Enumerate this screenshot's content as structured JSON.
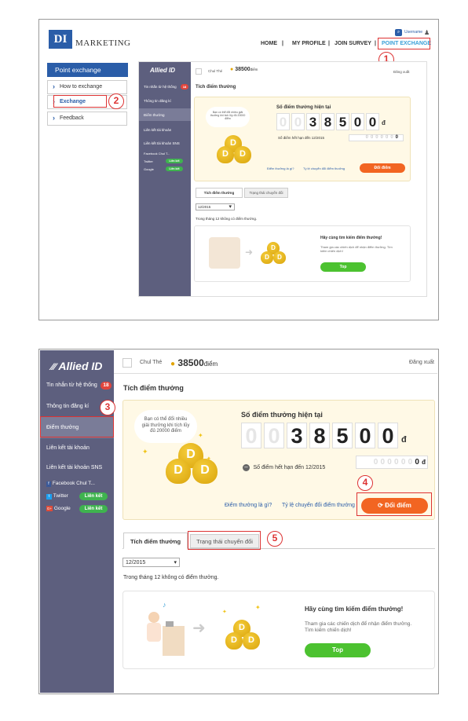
{
  "top": {
    "logo_di": "DI",
    "logo_marketing": "MARKETING",
    "username": "Username",
    "nav": [
      "HOME",
      "|",
      "MY PROFILE",
      "|",
      "JOIN SURVEY",
      "|",
      "POINT EXCHANGE"
    ],
    "sidebar_title": "Point exchange",
    "sidebar_items": [
      "How to exchange",
      "Exchange",
      "Feedback"
    ],
    "steps": [
      "1",
      "2"
    ]
  },
  "allied": {
    "brand": "Allied ID",
    "user_name": "Chul Thé",
    "points": "38500",
    "points_unit": "điểm",
    "logout": "Đăng xuất",
    "menu": [
      "Tin nhắn từ hệ thống",
      "Thông tin đăng kí",
      "Điểm thưởng",
      "Liên kết tài khoản",
      "Liên kết tài khoản SNS"
    ],
    "badge": "18",
    "sns": [
      {
        "name": "Facebook",
        "value": "Chul T..."
      },
      {
        "name": "Twitter",
        "value": "Liên kết"
      },
      {
        "name": "Google",
        "value": "Liên kết"
      }
    ],
    "section_title": "Tích điểm thưởng",
    "bubble": "Bạn có thể đổi nhiều giải thưởng khi tích lũy đủ 20000 điểm",
    "current_label": "Số điểm thưởng hiện tại",
    "digits": [
      "0",
      "0",
      "3",
      "8",
      "5",
      "0",
      "0"
    ],
    "digits_unit": "đ",
    "expire_label": "Số điểm hết hạn đến 12/2015",
    "expire_digits": [
      "0",
      "0",
      "0",
      "0",
      "0",
      "0",
      "0"
    ],
    "link_what": "Điểm thưởng là gì?",
    "link_rate": "Tỷ lệ chuyển đổi điểm thưởng",
    "exchange_btn": "Đổi điểm",
    "tabs": [
      "Tích điểm thưởng",
      "Trạng thái chuyển đổi"
    ],
    "month": "12/2015",
    "no_points": "Trong tháng 12 không có điểm thưởng.",
    "promo_title": "Hãy cùng tìm kiếm điểm thưởng!",
    "promo_text": "Tham gia các chiến dịch để nhận điểm thưởng. Tìm kiếm chiến dịch!",
    "top_btn": "Top",
    "bag_letter": "D",
    "steps": [
      "3",
      "4",
      "5"
    ]
  }
}
